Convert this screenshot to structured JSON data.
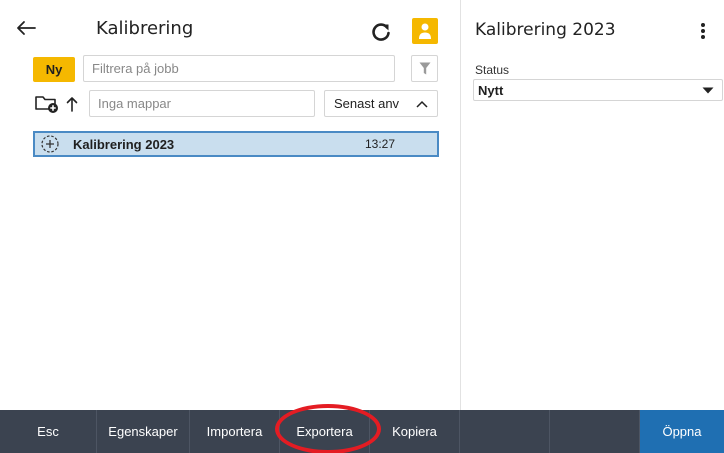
{
  "header": {
    "title": "Kalibrering"
  },
  "toolbar": {
    "new_label": "Ny",
    "filter_placeholder": "Filtrera på jobb",
    "folders_placeholder": "Inga mappar",
    "sort_label": "Senast anv"
  },
  "jobs": [
    {
      "name": "Kalibrering 2023",
      "time": "13:27"
    }
  ],
  "detail": {
    "title": "Kalibrering 2023",
    "status_label": "Status",
    "status_value": "Nytt"
  },
  "bottom_bar": {
    "esc": "Esc",
    "properties": "Egenskaper",
    "import": "Importera",
    "export": "Exportera",
    "copy": "Kopiera",
    "open": "Öppna"
  },
  "colors": {
    "accent": "#f5b800",
    "selection": "#c9deee",
    "selection_border": "#4a8ac4",
    "toolbar_bg": "#3b4350",
    "primary_button": "#1f6fb2",
    "annotation": "#e41c23"
  },
  "icons": {
    "back": "arrow-left-icon",
    "refresh": "refresh-icon",
    "user": "user-icon",
    "filter": "funnel-icon",
    "new_folder": "new-folder-icon",
    "up": "arrow-up-icon",
    "sort_direction": "chevron-up-icon",
    "job": "job-add-icon",
    "more": "more-vertical-icon",
    "dropdown": "caret-down-icon"
  }
}
